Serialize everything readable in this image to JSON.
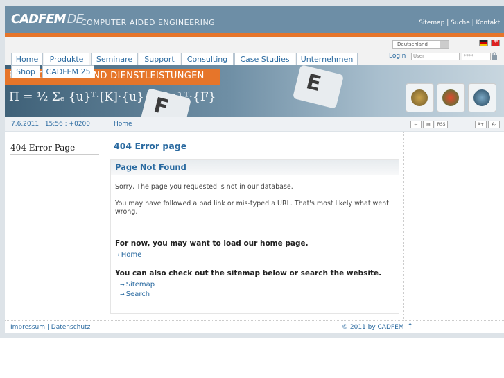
{
  "header": {
    "logo_main": "CADFEM",
    "logo_suffix": "DE",
    "tagline": "COMPUTER AIDED ENGINEERING",
    "links": [
      "Sitemap",
      "Suche",
      "Kontakt"
    ]
  },
  "lang_select": "Deutschland",
  "login": {
    "label": "Login",
    "user_placeholder": "User",
    "pass_placeholder": "****"
  },
  "nav": {
    "tabs": [
      "Home",
      "Produkte",
      "Seminare",
      "Support",
      "Consulting",
      "Case Studies",
      "Unternehmen"
    ],
    "tabs2": [
      "Shop",
      "CADFEM 25"
    ]
  },
  "banner": {
    "title": "FEM-SOFTWARE UND DIENSTLEISTUNGEN",
    "formula": "Π = ½ Σₑ {u}ᵀ·[K]·{u} − {u}ᵀ·{F}",
    "keys": [
      "E",
      "F"
    ]
  },
  "infobar": {
    "date": "7.6.2011 : 15:56 : +0200",
    "breadcrumb": "Home",
    "rss": "RSS",
    "font_larger": "A+",
    "font_smaller": "A-"
  },
  "sidebar": {
    "title": "404 Error Page"
  },
  "main": {
    "heading": "404 Error page",
    "box_title": "Page Not Found",
    "p1": "Sorry, The page you requested is not in our database.",
    "p2": "You may have followed a bad link or mis-typed a URL. That's most likely what went wrong.",
    "home_hint": "For now, you may want to load our home page.",
    "home_link": "Home",
    "sitemap_hint": "You can also check out the sitemap below or search the website.",
    "sitemap_link": "Sitemap",
    "search_link": "Search"
  },
  "footer": {
    "impressum": "Impressum",
    "datenschutz": "Datenschutz",
    "copyright": "© 2011 by CADFEM"
  },
  "colors": {
    "header": "#6d8ea6",
    "accent": "#e6752a",
    "link": "#2a6aa0"
  }
}
